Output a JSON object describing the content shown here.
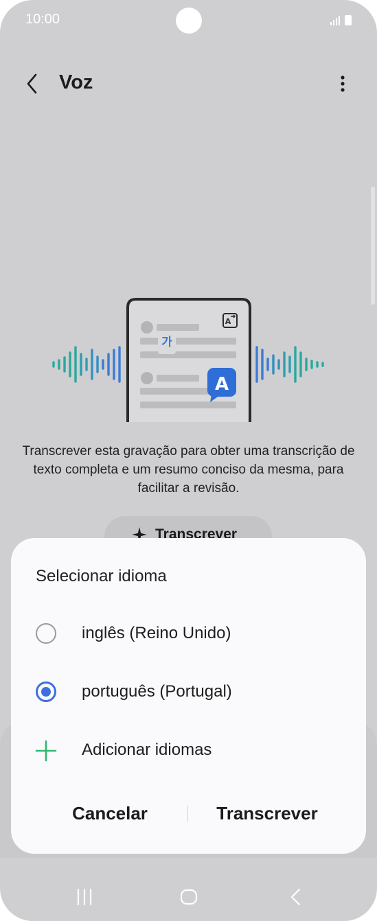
{
  "status_bar": {
    "time": "10:00"
  },
  "header": {
    "title": "Voz"
  },
  "main": {
    "illustration": {
      "hangul_glyph": "가",
      "latin_glyph": "A"
    },
    "description": "Transcrever esta gravação para obter uma transcrição de texto completa e um resumo conciso da mesma, para facilitar a revisão.",
    "transcribe_button_label": "Transcrever"
  },
  "dialog": {
    "title": "Selecionar idioma",
    "options": [
      {
        "label": "inglês (Reino Unido)",
        "selected": false
      },
      {
        "label": "português (Portugal)",
        "selected": true
      }
    ],
    "add_languages_label": "Adicionar idiomas",
    "cancel_label": "Cancelar",
    "confirm_label": "Transcrever"
  },
  "colors": {
    "accent": "#3e6ee0",
    "add_icon": "#2eb872",
    "wave_teal": "#2aa89c",
    "wave_blue": "#3a7bd5",
    "scrim_background": "#cfcfd1"
  },
  "icons": [
    "back-arrow-icon",
    "more-options-icon",
    "sparkle-icon",
    "plus-icon",
    "translate-icon",
    "recents-icon",
    "home-icon",
    "back-nav-icon"
  ]
}
